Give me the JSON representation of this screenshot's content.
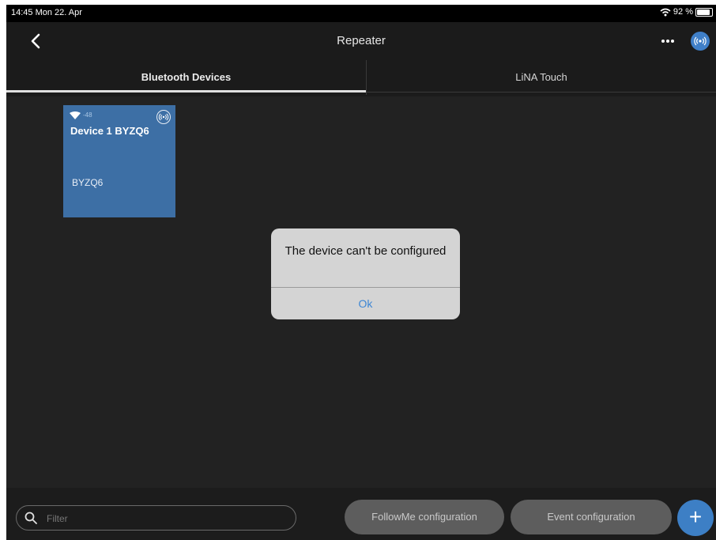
{
  "status_bar": {
    "time_date": "14:45  Mon 22. Apr",
    "battery_text": "92 %",
    "battery_level": 0.92
  },
  "header": {
    "title": "Repeater",
    "back_icon": "chevron-left-icon",
    "more_icon": "ellipsis-icon",
    "radio_icon": "broadcast-icon"
  },
  "tabs": [
    {
      "label": "Bluetooth Devices",
      "active": true
    },
    {
      "label": "LiNA Touch",
      "active": false
    }
  ],
  "device_card": {
    "signal": "-48",
    "name": "Device 1 BYZQ6",
    "code": "BYZQ6",
    "color": "#3d6fa5"
  },
  "dialog": {
    "message": "The device can't be configured",
    "ok_label": "Ok"
  },
  "bottom_bar": {
    "filter_placeholder": "Filter",
    "followme_label": "FollowMe configuration",
    "event_label": "Event configuration",
    "add_label": "+"
  },
  "colors": {
    "accent": "#3d7fc5",
    "background": "#222222"
  }
}
